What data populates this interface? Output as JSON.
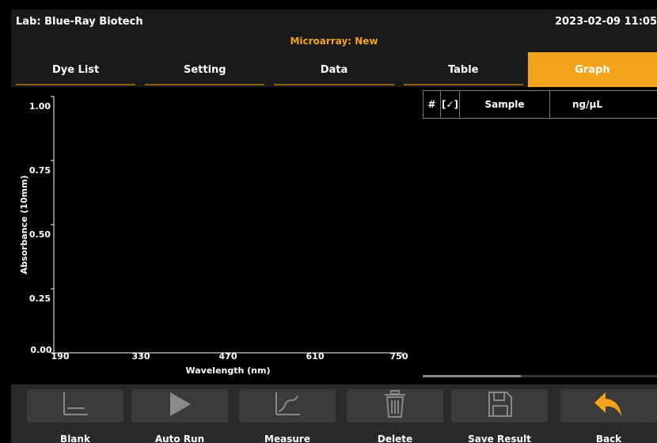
{
  "header": {
    "lab": "Lab: Blue-Ray Biotech",
    "datetime": "2023-02-09 11:05",
    "mode": "Microarray: New"
  },
  "tabs": [
    {
      "label": "Dye List",
      "active": false
    },
    {
      "label": "Setting",
      "active": false
    },
    {
      "label": "Data",
      "active": false
    },
    {
      "label": "Table",
      "active": false
    },
    {
      "label": "Graph",
      "active": true
    }
  ],
  "graph": {
    "y_axis_title": "Absorbance (10mm)",
    "x_axis_title": "Wavelength (nm)",
    "y_ticks": [
      "0.00",
      "0.25",
      "0.50",
      "0.75",
      "1.00"
    ],
    "x_ticks": [
      "190",
      "330",
      "470",
      "610",
      "750"
    ]
  },
  "table": {
    "columns": [
      "#",
      "[✓]",
      "Sample",
      "ng/μL"
    ],
    "rows": []
  },
  "footer": {
    "buttons": [
      {
        "label": "Blank",
        "icon": "blank-icon"
      },
      {
        "label": "Auto Run",
        "icon": "play-icon"
      },
      {
        "label": "Measure",
        "icon": "measure-icon"
      },
      {
        "label": "Delete",
        "icon": "trash-icon"
      },
      {
        "label": "Save Result",
        "icon": "save-icon"
      },
      {
        "label": "Back",
        "icon": "back-arrow-icon"
      }
    ]
  },
  "colors": {
    "accent": "#f3a21b",
    "background": "#000000",
    "panel": "#1a1a1a",
    "button": "#3b3b3b"
  }
}
